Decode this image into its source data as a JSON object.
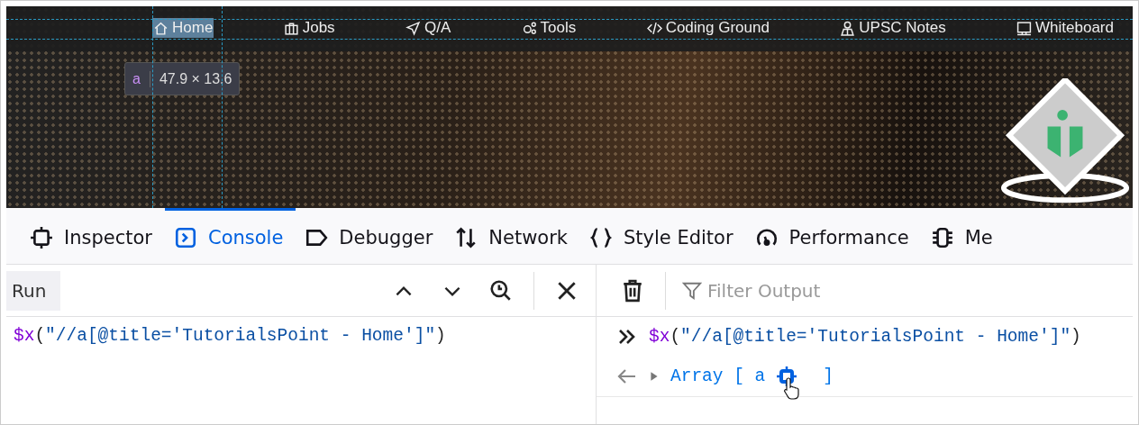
{
  "webpage": {
    "nav_items": [
      {
        "label": "Home",
        "kind": "home",
        "selected": true
      },
      {
        "label": "Jobs",
        "kind": "briefcase",
        "selected": false
      },
      {
        "label": "Q/A",
        "kind": "send",
        "selected": false
      },
      {
        "label": "Tools",
        "kind": "gears",
        "selected": false
      },
      {
        "label": "Coding Ground",
        "kind": "code",
        "selected": false
      },
      {
        "label": "UPSC Notes",
        "kind": "person",
        "selected": false
      },
      {
        "label": "Whiteboard",
        "kind": "board",
        "selected": false
      }
    ],
    "tooltip": {
      "tag": "a",
      "size": "47.9 × 13.6"
    }
  },
  "devtools": {
    "tabs": [
      {
        "label": "Inspector",
        "kind": "inspector",
        "selected": false
      },
      {
        "label": "Console",
        "kind": "console",
        "selected": true
      },
      {
        "label": "Debugger",
        "kind": "debugger",
        "selected": false
      },
      {
        "label": "Network",
        "kind": "network",
        "selected": false
      },
      {
        "label": "Style Editor",
        "kind": "braces",
        "selected": false
      },
      {
        "label": "Performance",
        "kind": "gauge",
        "selected": false
      },
      {
        "label": "Me",
        "kind": "chip",
        "selected": false
      }
    ],
    "editor": {
      "run_button": "Run",
      "code": [
        {
          "kind": "fn",
          "text": "$x"
        },
        {
          "kind": "punct",
          "text": "("
        },
        {
          "kind": "string",
          "text": "\"//a[@title='TutorialsPoint - Home']\""
        },
        {
          "kind": "punct",
          "text": ")"
        }
      ]
    },
    "output": {
      "filter_placeholder": "Filter Output",
      "input_line": [
        {
          "kind": "fn",
          "text": "$x"
        },
        {
          "kind": "punct",
          "text": "("
        },
        {
          "kind": "string",
          "text": "\"//a[@title='TutorialsPoint - Home']\""
        },
        {
          "kind": "punct",
          "text": ")"
        }
      ],
      "result_open": "Array [ a",
      "result_close": "]"
    }
  }
}
